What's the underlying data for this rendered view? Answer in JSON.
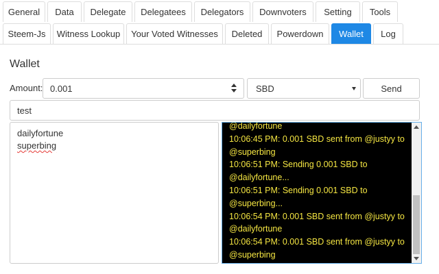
{
  "tabs": {
    "row1": [
      "General",
      "Data",
      "Delegate",
      "Delegatees",
      "Delegators",
      "Downvoters",
      "Setting",
      "Tools"
    ],
    "row2": [
      "Steem-Js",
      "Witness Lookup",
      "Your Voted Witnesses",
      "Deleted",
      "Powerdown",
      "Wallet",
      "Log"
    ],
    "active": "Wallet"
  },
  "wallet": {
    "title": "Wallet",
    "amount_label": "Amount:",
    "amount_value": "0.001",
    "currency": "SBD",
    "send_label": "Send",
    "memo": "test",
    "recipients": [
      "dailyfortune",
      "superbing"
    ]
  },
  "log": {
    "lines": [
      "@dailyfortune",
      "10:06:45 PM: 0.001 SBD sent from @justyy to",
      "@superbing",
      "10:06:51 PM: Sending 0.001 SBD to",
      "@dailyfortune...",
      "10:06:51 PM: Sending 0.001 SBD to",
      "@superbing...",
      "10:06:54 PM: 0.001 SBD sent from @justyy to",
      "@dailyfortune",
      "10:06:54 PM: 0.001 SBD sent from @justyy to",
      "@superbing"
    ]
  },
  "colors": {
    "accent": "#1e88e5",
    "log_bg": "#000000",
    "log_text": "#f5e642"
  }
}
